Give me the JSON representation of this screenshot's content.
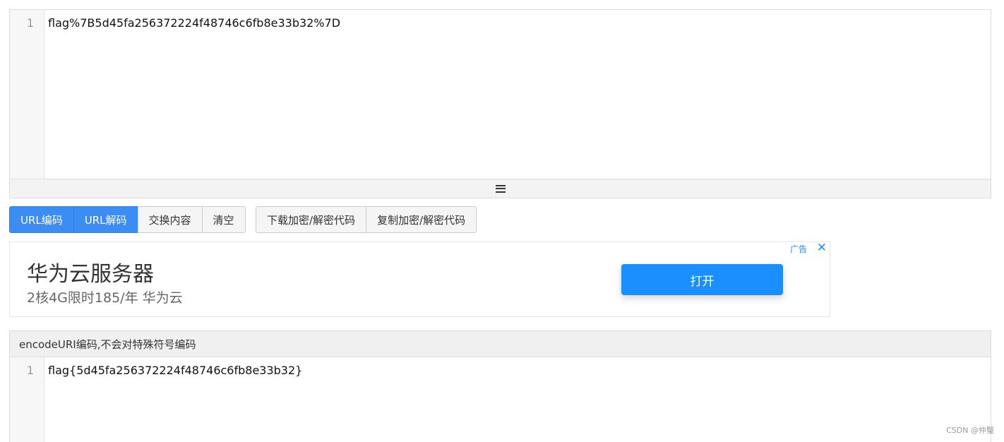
{
  "input_editor": {
    "line_number": "1",
    "content": "flag%7B5d45fa256372224f48746c6fb8e33b32%7D"
  },
  "buttons": {
    "url_encode": "URL编码",
    "url_decode": "URL解码",
    "swap": "交换内容",
    "clear": "清空",
    "download_code": "下载加密/解密代码",
    "copy_code": "复制加密/解密代码"
  },
  "ad": {
    "title": "华为云服务器",
    "subtitle": "2核4G限时185/年 华为云",
    "open_button": "打开",
    "label": "广告",
    "close": "✕"
  },
  "output_panel": {
    "title": "encodeURI编码,不会对特殊符号编码",
    "line_number": "1",
    "content": "flag{5d45fa256372224f48746c6fb8e33b32}"
  },
  "watermark": "CSDN @仲瑿",
  "colors": {
    "primary": "#3b8cf3",
    "ad_button": "#1b8ffe"
  }
}
